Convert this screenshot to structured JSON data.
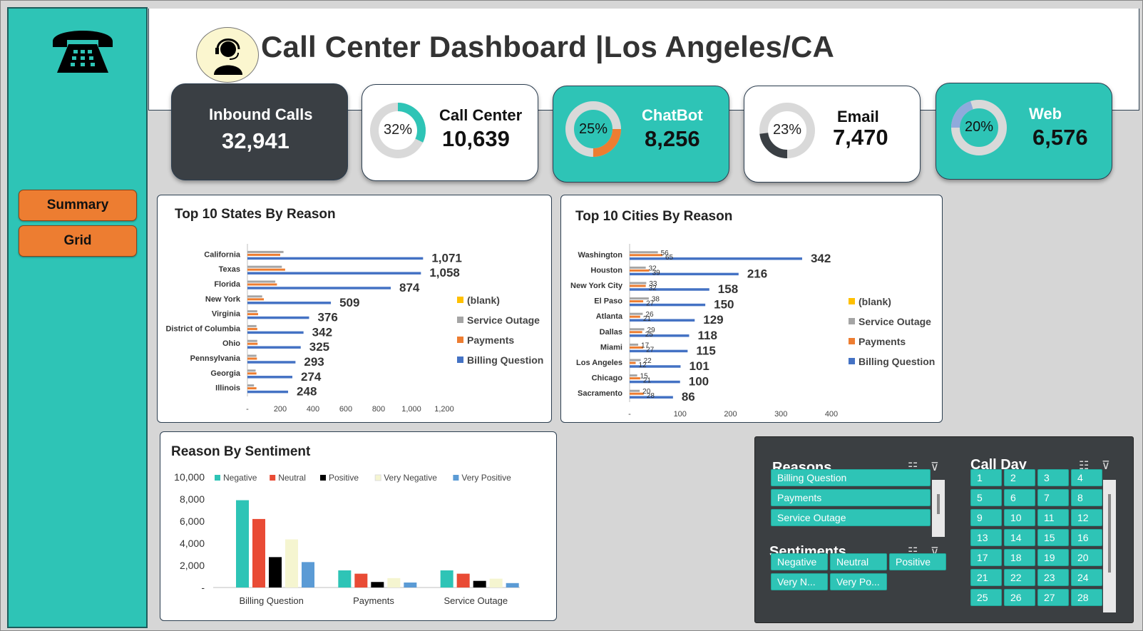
{
  "header": {
    "title": "Call Center Dashboard |Los Angeles/CA"
  },
  "sidebar": {
    "summary_label": "Summary",
    "grid_label": "Grid"
  },
  "kpis": {
    "inbound": {
      "label": "Inbound Calls",
      "value": "32,941"
    },
    "call_center": {
      "label": "Call Center",
      "value": "10,639",
      "pct_label": "32%",
      "pct": 0.32
    },
    "chatbot": {
      "label": "ChatBot",
      "value": "8,256",
      "pct_label": "25%",
      "pct": 0.25
    },
    "email": {
      "label": "Email",
      "value": "7,470",
      "pct_label": "23%",
      "pct": 0.23
    },
    "web": {
      "label": "Web",
      "value": "6,576",
      "pct_label": "20%",
      "pct": 0.2
    }
  },
  "colors": {
    "teal": "#2ec4b6",
    "dark": "#3a3f44",
    "orange": "#ed7d31",
    "billing": "#4472c4",
    "payments": "#ed7d31",
    "outage": "#a5a5a5",
    "blank": "#ffc000",
    "negative": "#2ec4b6",
    "neutral": "#e94b35",
    "positive": "#000000",
    "very_negative": "#f5f5d0",
    "very_positive": "#5b9bd5"
  },
  "icons": {
    "phone": "telephone-icon",
    "agent": "headset-agent-icon",
    "multiselect": "multi-select-icon",
    "clear_filter": "clear-filter-icon"
  },
  "chart_data": [
    {
      "type": "bar",
      "orientation": "horizontal",
      "title": "Top 10 States By Reason",
      "categories": [
        "California",
        "Texas",
        "Florida",
        "New York",
        "Virginia",
        "District of Columbia",
        "Ohio",
        "Pennsylvania",
        "Georgia",
        "Illinois"
      ],
      "series": [
        {
          "name": "(blank)",
          "values": [
            0,
            0,
            0,
            0,
            0,
            0,
            0,
            0,
            0,
            0
          ]
        },
        {
          "name": "Service Outage",
          "values": [
            220,
            210,
            170,
            90,
            60,
            55,
            60,
            55,
            50,
            40
          ]
        },
        {
          "name": "Payments",
          "values": [
            200,
            230,
            180,
            100,
            65,
            60,
            62,
            58,
            55,
            55
          ]
        },
        {
          "name": "Billing Question",
          "values": [
            1071,
            1058,
            874,
            509,
            376,
            342,
            325,
            293,
            274,
            248
          ]
        }
      ],
      "data_labels": [
        "1,071",
        "1,058",
        "874",
        "509",
        "376",
        "342",
        "325",
        "293",
        "274",
        "248"
      ],
      "x_ticks": [
        "-",
        "200",
        "400",
        "600",
        "800",
        "1,000",
        "1,200"
      ],
      "xlim": [
        0,
        1200
      ],
      "legend": "right"
    },
    {
      "type": "bar",
      "orientation": "horizontal",
      "title": "Top 10 Cities By Reason",
      "categories": [
        "Washington",
        "Houston",
        "New York City",
        "El Paso",
        "Atlanta",
        "Dallas",
        "Miami",
        "Los Angeles",
        "Chicago",
        "Sacramento"
      ],
      "series": [
        {
          "name": "(blank)",
          "values": [
            0,
            0,
            0,
            0,
            0,
            0,
            0,
            0,
            0,
            0
          ]
        },
        {
          "name": "Service Outage",
          "values": [
            56,
            32,
            33,
            38,
            26,
            29,
            17,
            22,
            15,
            20
          ]
        },
        {
          "name": "Payments",
          "values": [
            65,
            39,
            32,
            27,
            21,
            25,
            27,
            12,
            21,
            28
          ]
        },
        {
          "name": "Billing Question",
          "values": [
            342,
            216,
            158,
            150,
            129,
            118,
            115,
            101,
            100,
            86
          ]
        }
      ],
      "outage_labels": [
        "56",
        "32",
        "33",
        "38",
        "26",
        "29",
        "17",
        "22",
        "15",
        "20"
      ],
      "payments_labels": [
        "65",
        "39",
        "32",
        "27",
        "21",
        "25",
        "27",
        "12",
        "21",
        "28"
      ],
      "data_labels": [
        "342",
        "216",
        "158",
        "150",
        "129",
        "118",
        "115",
        "101",
        "100",
        "86"
      ],
      "x_ticks": [
        "-",
        "100",
        "200",
        "300",
        "400"
      ],
      "xlim": [
        0,
        400
      ],
      "legend": "right"
    },
    {
      "type": "bar",
      "title": "Reason By Sentiment",
      "categories": [
        "Billing Question",
        "Payments",
        "Service Outage"
      ],
      "series": [
        {
          "name": "Negative",
          "values": [
            7900,
            1550,
            1550
          ]
        },
        {
          "name": "Neutral",
          "values": [
            6200,
            1250,
            1250
          ]
        },
        {
          "name": "Positive",
          "values": [
            2750,
            500,
            600
          ]
        },
        {
          "name": "Very Negative",
          "values": [
            4350,
            850,
            800
          ]
        },
        {
          "name": "Very Positive",
          "values": [
            2300,
            450,
            400
          ]
        }
      ],
      "y_ticks": [
        "10,000",
        "8,000",
        "6,000",
        "4,000",
        "2,000",
        "-"
      ],
      "ylim": [
        0,
        10000
      ],
      "legend": "top"
    }
  ],
  "slicers": {
    "reasons": {
      "title": "Reasons",
      "items": [
        "Billing Question",
        "Payments",
        "Service Outage"
      ]
    },
    "sentiments": {
      "title": "Sentiments",
      "items": [
        "Negative",
        "Neutral",
        "Positive",
        "Very N...",
        "Very Po..."
      ]
    },
    "call_day": {
      "title": "Call Day",
      "items": [
        "1",
        "2",
        "3",
        "4",
        "5",
        "6",
        "7",
        "8",
        "9",
        "10",
        "11",
        "12",
        "13",
        "14",
        "15",
        "16",
        "17",
        "18",
        "19",
        "20",
        "21",
        "22",
        "23",
        "24",
        "25",
        "26",
        "27",
        "28"
      ]
    }
  }
}
